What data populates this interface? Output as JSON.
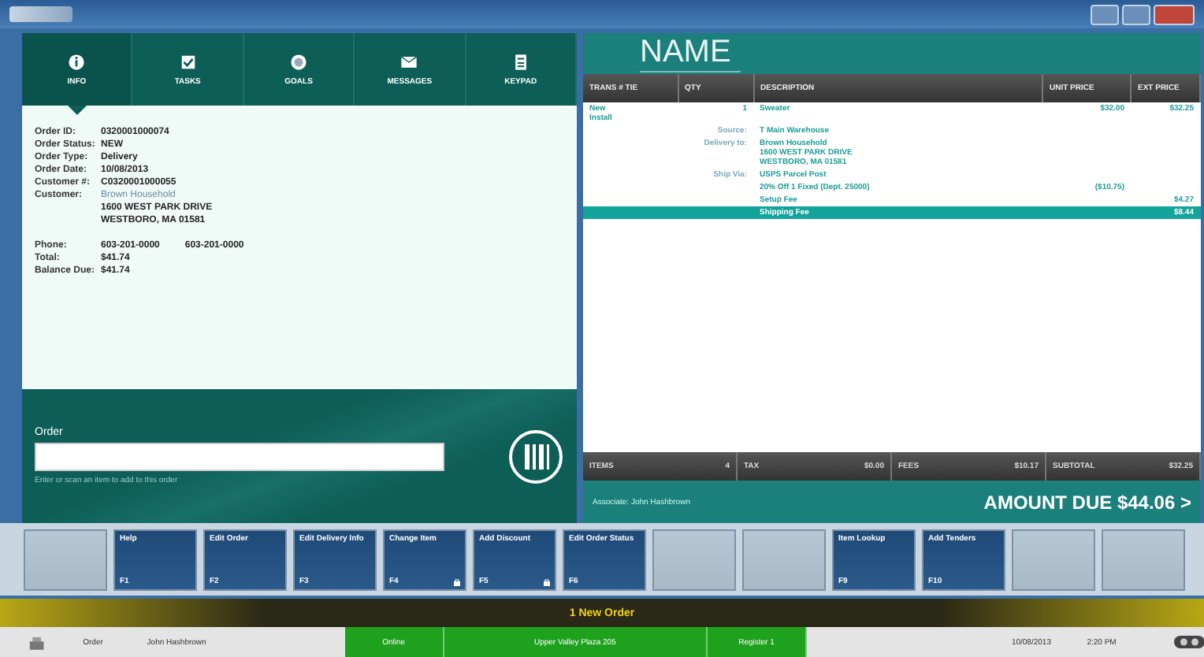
{
  "tabs": [
    {
      "label": "INFO",
      "selected": true
    },
    {
      "label": "TASKS",
      "selected": false
    },
    {
      "label": "GOALS",
      "selected": false
    },
    {
      "label": "MESSAGES",
      "selected": false
    },
    {
      "label": "KEYPAD",
      "selected": false
    }
  ],
  "info": [
    {
      "label": "Order ID:",
      "values": [
        "0320001000074"
      ]
    },
    {
      "label": "Order Status:",
      "values": [
        "NEW"
      ]
    },
    {
      "label": "Order Type:",
      "values": [
        "Delivery"
      ]
    },
    {
      "label": "Order Date:",
      "values": [
        "10/08/2013"
      ]
    },
    {
      "label": "Customer #:",
      "values": [
        "C0320001000055"
      ]
    },
    {
      "label": "Customer:",
      "values": [
        "Brown Household"
      ],
      "link": true
    },
    {
      "values": [
        "1600 WEST PARK DRIVE"
      ]
    },
    {
      "values": [
        "WESTBORO, MA 01581"
      ]
    },
    {
      "label": "Phone:",
      "values": [
        "603-201-0000",
        "603-201-0000"
      ],
      "gap": true
    },
    {
      "label": "Total:",
      "values": [
        "$41.74"
      ]
    },
    {
      "label": "Balance Due:",
      "values": [
        "$41.74"
      ]
    }
  ],
  "order_entry": {
    "label": "Order",
    "hint": "Enter or scan an item to add to this order"
  },
  "receipt": {
    "title": "NAME",
    "columns": [
      "TRANS # TIE",
      "QTY",
      "DESCRIPTION",
      "UNIT PRICE",
      "EXT PRICE"
    ],
    "rows": [
      {
        "kind": "item",
        "trans": [
          "New",
          "Install"
        ],
        "qty": "1",
        "description": "Sweater",
        "unit": "$32.00",
        "ext": "$32.25",
        "selected": false
      },
      {
        "kind": "detail",
        "label": "Source:",
        "lines": [
          "T Main Warehouse"
        ],
        "selected": false
      },
      {
        "kind": "detail",
        "label": "Delivery to:",
        "lines": [
          "Brown Household",
          "1600 WEST PARK DRIVE",
          "WESTBORO, MA 01581"
        ],
        "selected": false
      },
      {
        "kind": "detail",
        "label": "Ship Via:",
        "lines": [
          "USPS Parcel Post"
        ],
        "selected": false
      },
      {
        "kind": "discount",
        "description": "20% Off 1 Fixed (Dept. 25000)",
        "unit": "($10.75)",
        "selected": false
      },
      {
        "kind": "fee",
        "description": "Setup Fee",
        "ext": "$4.27",
        "selected": false
      },
      {
        "kind": "fee",
        "description": "Shipping Fee",
        "ext": "$8.44",
        "selected": true
      }
    ],
    "totals": [
      {
        "label": "ITEMS",
        "value": "4"
      },
      {
        "label": "TAX",
        "value": "$0.00"
      },
      {
        "label": "FEES",
        "value": "$10.17"
      },
      {
        "label": "SUBTOTAL",
        "value": "$32.25"
      }
    ],
    "associate": "Associate:  John Hashbrown",
    "amount_due": "AMOUNT DUE  $44.06 >"
  },
  "function_keys": [
    {
      "kind": "empty"
    },
    {
      "kind": "key",
      "label": "Help",
      "key": "F1",
      "locked": false
    },
    {
      "kind": "key",
      "label": "Edit Order",
      "key": "F2",
      "locked": false
    },
    {
      "kind": "key",
      "label": "Edit Delivery Info",
      "key": "F3",
      "locked": false
    },
    {
      "kind": "key",
      "label": "Change Item",
      "key": "F4",
      "locked": true
    },
    {
      "kind": "key",
      "label": "Add Discount",
      "key": "F5",
      "locked": true
    },
    {
      "kind": "key",
      "label": "Edit Order Status",
      "key": "F6",
      "locked": false
    },
    {
      "kind": "empty"
    },
    {
      "kind": "empty"
    },
    {
      "kind": "key",
      "label": "Item Lookup",
      "key": "F9",
      "locked": false
    },
    {
      "kind": "key",
      "label": "Add Tenders",
      "key": "F10",
      "locked": false
    },
    {
      "kind": "empty"
    },
    {
      "kind": "empty"
    }
  ],
  "banner": "1 New Order",
  "status_bar": {
    "mode": "Order",
    "user": "John Hashbrown",
    "cells": [
      {
        "text": "Online",
        "wide": false
      },
      {
        "text": "Upper Valley Plaza 205",
        "wide": true
      },
      {
        "text": "Register 1",
        "wide": false
      }
    ],
    "date": "10/08/2013",
    "time": "2:20 PM"
  }
}
